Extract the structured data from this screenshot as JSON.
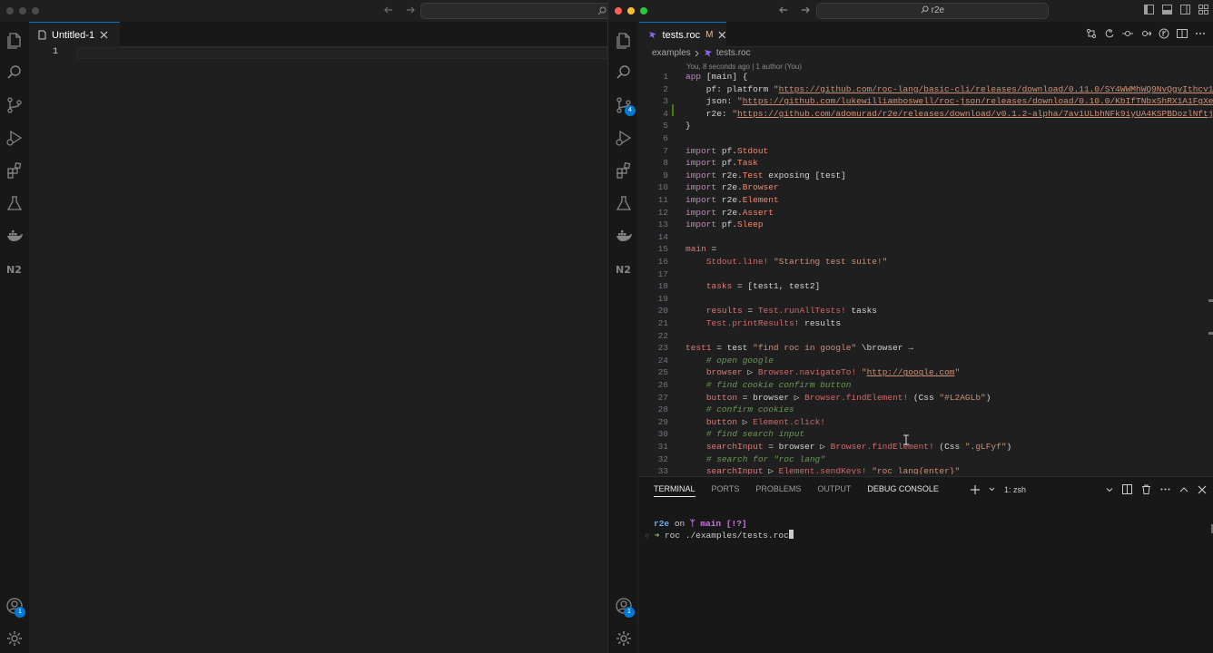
{
  "left_window": {
    "tab": {
      "title": "Untitled-1"
    },
    "editor": {
      "line_number": "1"
    },
    "accounts_badge": "1"
  },
  "right_window": {
    "command_center": {
      "text": "r2e"
    },
    "tab": {
      "title": "tests.roc",
      "modified": "M"
    },
    "breadcrumb": {
      "folder": "examples",
      "file": "tests.roc"
    },
    "blame": "You, 8 seconds ago | 1 author (You)",
    "scm_badge": "4",
    "accounts_badge": "1",
    "code_lines": [
      {
        "n": "1",
        "tokens": [
          [
            "kw",
            "app"
          ],
          [
            "pl",
            " "
          ],
          [
            "pl",
            "[main] {"
          ]
        ]
      },
      {
        "n": "2",
        "tokens": [
          [
            "pl",
            "    pf: platform "
          ],
          [
            "st",
            "\""
          ],
          [
            "url",
            "https://github.com/roc-lang/basic-cli/releases/download/0.11.0/SY4WWMhWQ9NvQgvIthcv15AU"
          ]
        ]
      },
      {
        "n": "3",
        "tokens": [
          [
            "pl",
            "    json: "
          ],
          [
            "st",
            "\""
          ],
          [
            "url",
            "https://github.com/lukewilliamboswell/roc-json/releases/download/0.10.0/KbIfTNbxShRX1A1FgXei1S"
          ]
        ]
      },
      {
        "n": "4",
        "tokens": [
          [
            "pl",
            "    r2e: "
          ],
          [
            "st",
            "\""
          ],
          [
            "url",
            "https://github.com/adomurad/r2e/releases/download/v0.1.2-alpha/7av1ULbhNFk9iyUA4KSPBDozlNftjsC"
          ]
        ]
      },
      {
        "n": "5",
        "tokens": [
          [
            "pl",
            "}"
          ]
        ]
      },
      {
        "n": "6",
        "tokens": []
      },
      {
        "n": "7",
        "tokens": [
          [
            "kw",
            "import"
          ],
          [
            "pl",
            " pf."
          ],
          [
            "mod",
            "Stdout"
          ]
        ]
      },
      {
        "n": "8",
        "tokens": [
          [
            "kw",
            "import"
          ],
          [
            "pl",
            " pf."
          ],
          [
            "mod",
            "Task"
          ]
        ]
      },
      {
        "n": "9",
        "tokens": [
          [
            "kw",
            "import"
          ],
          [
            "pl",
            " r2e."
          ],
          [
            "mod",
            "Test"
          ],
          [
            "pl",
            " exposing [test]"
          ]
        ]
      },
      {
        "n": "10",
        "tokens": [
          [
            "kw",
            "import"
          ],
          [
            "pl",
            " r2e."
          ],
          [
            "mod",
            "Browser"
          ]
        ]
      },
      {
        "n": "11",
        "tokens": [
          [
            "kw",
            "import"
          ],
          [
            "pl",
            " r2e."
          ],
          [
            "mod",
            "Element"
          ]
        ]
      },
      {
        "n": "12",
        "tokens": [
          [
            "kw",
            "import"
          ],
          [
            "pl",
            " r2e."
          ],
          [
            "mod",
            "Assert"
          ]
        ]
      },
      {
        "n": "13",
        "tokens": [
          [
            "kw",
            "import"
          ],
          [
            "pl",
            " pf."
          ],
          [
            "mod",
            "Sleep"
          ]
        ]
      },
      {
        "n": "14",
        "tokens": []
      },
      {
        "n": "15",
        "tokens": [
          [
            "var",
            "main"
          ],
          [
            "pl",
            " ="
          ]
        ]
      },
      {
        "n": "16",
        "tokens": [
          [
            "pl",
            "    "
          ],
          [
            "fn",
            "Stdout.line!"
          ],
          [
            "pl",
            " "
          ],
          [
            "st",
            "\"Starting test suite!\""
          ]
        ]
      },
      {
        "n": "17",
        "tokens": []
      },
      {
        "n": "18",
        "tokens": [
          [
            "pl",
            "    "
          ],
          [
            "var",
            "tasks"
          ],
          [
            "pl",
            " = [test1, test2]"
          ]
        ]
      },
      {
        "n": "19",
        "tokens": []
      },
      {
        "n": "20",
        "tokens": [
          [
            "pl",
            "    "
          ],
          [
            "var",
            "results"
          ],
          [
            "pl",
            " = "
          ],
          [
            "fn",
            "Test.runAllTests!"
          ],
          [
            "pl",
            " tasks"
          ]
        ]
      },
      {
        "n": "21",
        "tokens": [
          [
            "pl",
            "    "
          ],
          [
            "fn",
            "Test.printResults!"
          ],
          [
            "pl",
            " results"
          ]
        ]
      },
      {
        "n": "22",
        "tokens": []
      },
      {
        "n": "23",
        "tokens": [
          [
            "var",
            "test1"
          ],
          [
            "pl",
            " = test "
          ],
          [
            "st",
            "\"find roc in google\""
          ],
          [
            "pl",
            " \\browser →"
          ]
        ]
      },
      {
        "n": "24",
        "tokens": [
          [
            "pl",
            "    "
          ],
          [
            "cm",
            "# open google"
          ]
        ]
      },
      {
        "n": "25",
        "tokens": [
          [
            "pl",
            "    "
          ],
          [
            "var",
            "browser"
          ],
          [
            "pl",
            " ▷ "
          ],
          [
            "fn",
            "Browser.navigateTo!"
          ],
          [
            "pl",
            " "
          ],
          [
            "st",
            "\""
          ],
          [
            "url",
            "http://google.com"
          ],
          [
            "st",
            "\""
          ]
        ]
      },
      {
        "n": "26",
        "tokens": [
          [
            "pl",
            "    "
          ],
          [
            "cm",
            "# find cookie confirm button"
          ]
        ]
      },
      {
        "n": "27",
        "tokens": [
          [
            "pl",
            "    "
          ],
          [
            "var",
            "button"
          ],
          [
            "pl",
            " = browser ▷ "
          ],
          [
            "fn",
            "Browser.findElement!"
          ],
          [
            "pl",
            " (Css "
          ],
          [
            "st",
            "\"#L2AGLb\""
          ],
          [
            "pl",
            ")"
          ]
        ]
      },
      {
        "n": "28",
        "tokens": [
          [
            "pl",
            "    "
          ],
          [
            "cm",
            "# confirm cookies"
          ]
        ]
      },
      {
        "n": "29",
        "tokens": [
          [
            "pl",
            "    "
          ],
          [
            "var",
            "button"
          ],
          [
            "pl",
            " ▷ "
          ],
          [
            "fn",
            "Element.click!"
          ]
        ]
      },
      {
        "n": "30",
        "tokens": [
          [
            "pl",
            "    "
          ],
          [
            "cm",
            "# find search input"
          ]
        ]
      },
      {
        "n": "31",
        "tokens": [
          [
            "pl",
            "    "
          ],
          [
            "var",
            "searchInput"
          ],
          [
            "pl",
            " = browser ▷ "
          ],
          [
            "fn",
            "Browser.findElement!"
          ],
          [
            "pl",
            " (Css "
          ],
          [
            "st",
            "\".gLFyf\""
          ],
          [
            "pl",
            ")"
          ]
        ]
      },
      {
        "n": "32",
        "tokens": [
          [
            "pl",
            "    "
          ],
          [
            "cm",
            "# search for \"roc lang\""
          ]
        ]
      },
      {
        "n": "33",
        "tokens": [
          [
            "pl",
            "    "
          ],
          [
            "var",
            "searchInput"
          ],
          [
            "pl",
            " ▷ "
          ],
          [
            "fn",
            "Element.sendKeys!"
          ],
          [
            "pl",
            " "
          ],
          [
            "st",
            "\"roc lang{enter}\""
          ]
        ]
      }
    ],
    "panel": {
      "tabs": [
        "TERMINAL",
        "PORTS",
        "PROBLEMS",
        "OUTPUT",
        "DEBUG CONSOLE"
      ],
      "terminal_selector": "1: zsh",
      "prompt_dir": "r2e",
      "prompt_on": "on",
      "prompt_branch": "ᛘ main [!?]",
      "prompt_arrow": "➜",
      "command": "roc ./examples/tests.roc"
    }
  }
}
